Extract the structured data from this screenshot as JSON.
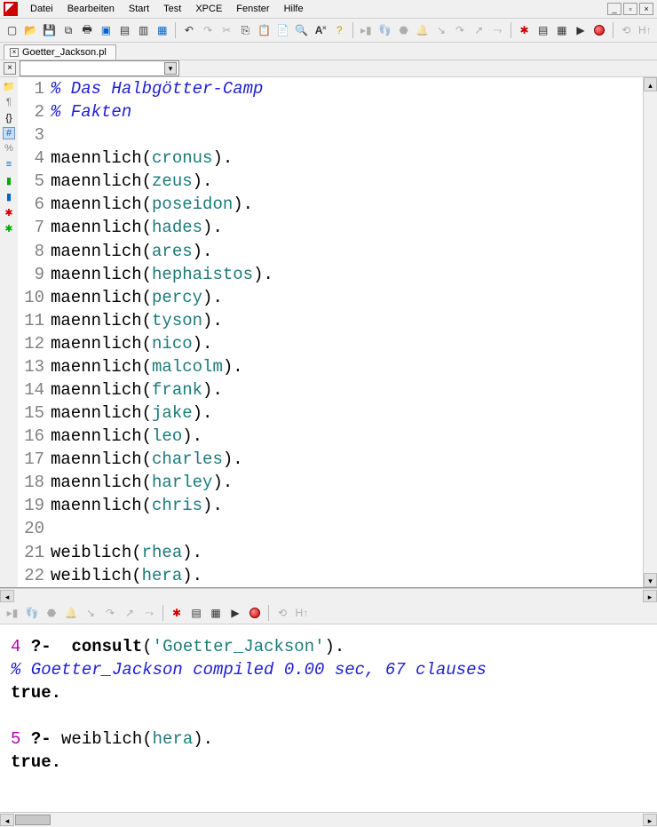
{
  "menu": {
    "items": [
      "Datei",
      "Bearbeiten",
      "Start",
      "Test",
      "XPCE",
      "Fenster",
      "Hilfe"
    ]
  },
  "tab": {
    "title": "Goetter_Jackson.pl"
  },
  "code_lines": [
    {
      "n": 1,
      "type": "comment",
      "text": "% Das Halbgötter-Camp"
    },
    {
      "n": 2,
      "type": "comment",
      "text": "% Fakten"
    },
    {
      "n": 3,
      "type": "blank",
      "text": ""
    },
    {
      "n": 4,
      "type": "fact",
      "pred": "maennlich",
      "arg": "cronus"
    },
    {
      "n": 5,
      "type": "fact",
      "pred": "maennlich",
      "arg": "zeus"
    },
    {
      "n": 6,
      "type": "fact",
      "pred": "maennlich",
      "arg": "poseidon"
    },
    {
      "n": 7,
      "type": "fact",
      "pred": "maennlich",
      "arg": "hades"
    },
    {
      "n": 8,
      "type": "fact",
      "pred": "maennlich",
      "arg": "ares"
    },
    {
      "n": 9,
      "type": "fact",
      "pred": "maennlich",
      "arg": "hephaistos"
    },
    {
      "n": 10,
      "type": "fact",
      "pred": "maennlich",
      "arg": "percy"
    },
    {
      "n": 11,
      "type": "fact",
      "pred": "maennlich",
      "arg": "tyson"
    },
    {
      "n": 12,
      "type": "fact",
      "pred": "maennlich",
      "arg": "nico"
    },
    {
      "n": 13,
      "type": "fact",
      "pred": "maennlich",
      "arg": "malcolm"
    },
    {
      "n": 14,
      "type": "fact",
      "pred": "maennlich",
      "arg": "frank"
    },
    {
      "n": 15,
      "type": "fact",
      "pred": "maennlich",
      "arg": "jake"
    },
    {
      "n": 16,
      "type": "fact",
      "pred": "maennlich",
      "arg": "leo"
    },
    {
      "n": 17,
      "type": "fact",
      "pred": "maennlich",
      "arg": "charles"
    },
    {
      "n": 18,
      "type": "fact",
      "pred": "maennlich",
      "arg": "harley"
    },
    {
      "n": 19,
      "type": "fact",
      "pred": "maennlich",
      "arg": "chris"
    },
    {
      "n": 20,
      "type": "blank",
      "text": ""
    },
    {
      "n": 21,
      "type": "fact",
      "pred": "weiblich",
      "arg": "rhea"
    },
    {
      "n": 22,
      "type": "fact",
      "pred": "weiblich",
      "arg": "hera"
    }
  ],
  "console": {
    "lines": [
      {
        "kind": "query",
        "num": "4",
        "cmd_prefix": "consult",
        "cmd_arg": "'Goetter_Jackson'"
      },
      {
        "kind": "comment",
        "text": "% Goetter_Jackson compiled 0.00 sec, 67 clauses"
      },
      {
        "kind": "result",
        "text": "true."
      },
      {
        "kind": "blank",
        "text": ""
      },
      {
        "kind": "query2",
        "num": "5",
        "pred": "weiblich",
        "arg": "hera"
      },
      {
        "kind": "result",
        "text": "true."
      }
    ]
  },
  "icons": {
    "toolbar1": [
      "new",
      "open",
      "save",
      "saveall",
      "print",
      "window",
      "split",
      "splitv",
      "screen"
    ],
    "toolbar2": [
      "undo",
      "redo",
      "cut",
      "copy",
      "paste",
      "paste2",
      "find",
      "font",
      "help"
    ],
    "toolbar3": [
      "compile",
      "trace",
      "stop",
      "spy",
      "stepin",
      "stepover",
      "stepout",
      "skip"
    ],
    "toolbar4": [
      "bug",
      "list1",
      "list2",
      "run",
      "record"
    ],
    "toolbar5": [
      "back",
      "hi"
    ],
    "left_gutter": [
      "folder",
      "para",
      "braces",
      "hash",
      "percent",
      "list",
      "db1",
      "db2",
      "bug",
      "bug2"
    ],
    "bottom_toolbar": [
      "compile",
      "trace",
      "stop",
      "spy",
      "stepin",
      "stepover",
      "stepout",
      "skip",
      "sep",
      "bug",
      "list1",
      "list2",
      "run",
      "record",
      "sep",
      "back",
      "hi"
    ]
  }
}
